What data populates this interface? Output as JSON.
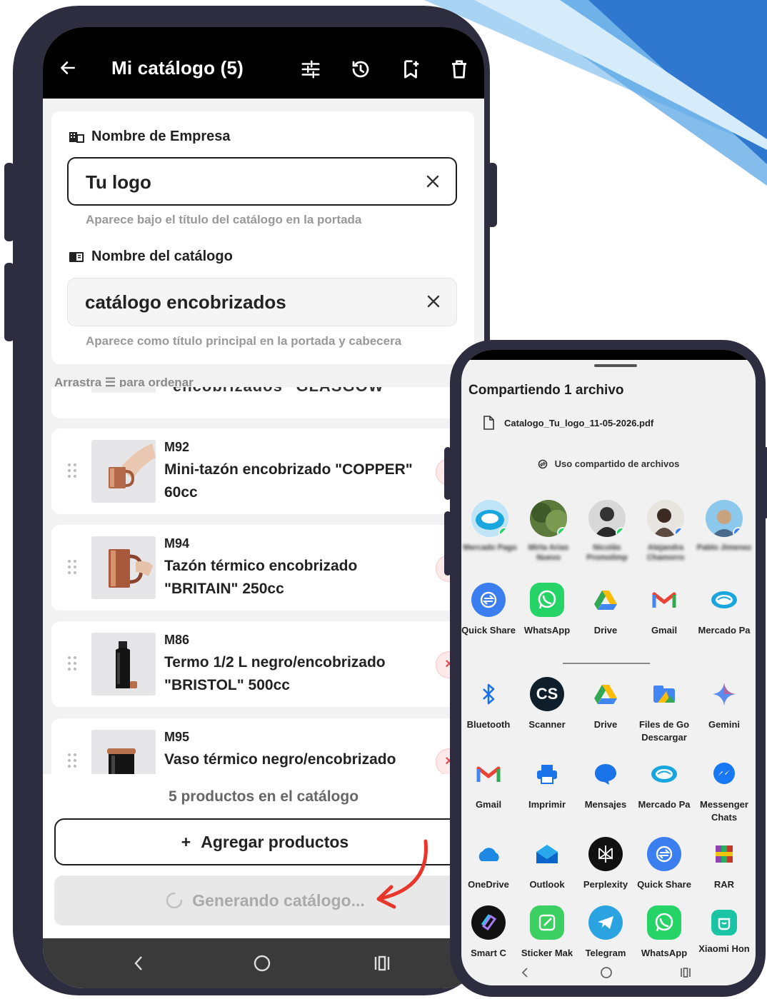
{
  "phone1": {
    "topbar": {
      "title": "Mi catálogo (5)",
      "icons": [
        "back-arrow-icon",
        "tune-icon",
        "history-icon",
        "bookmark-add-icon",
        "trash-icon"
      ]
    },
    "company": {
      "label": "Nombre de Empresa",
      "value": "Tu logo",
      "hint": "Aparece bajo el título del catálogo en la portada"
    },
    "catalog": {
      "label": "Nombre del catálogo",
      "value": "catálogo encobrizados",
      "hint": "Aparece como título principal en la portada y cabecera"
    },
    "drag_hint": "Arrastra ☰ para ordenar",
    "cut_item_text": "encobrizados \"GLASGOW\"",
    "products": [
      {
        "code": "M92",
        "name": "Mini-tazón encobrizado \"COPPER\" 60cc"
      },
      {
        "code": "M94",
        "name": "Tazón térmico encobrizado \"BRITAIN\" 250cc"
      },
      {
        "code": "M86",
        "name": "Termo 1/2 L negro/encobrizado \"BRISTOL\" 500cc"
      },
      {
        "code": "M95",
        "name": "Vaso térmico negro/encobrizado"
      }
    ],
    "remove_label": "×",
    "count_text": "5 productos en el catálogo",
    "add_button": "Agregar productos",
    "add_plus": "+",
    "generate_button": "Generando catálogo..."
  },
  "phone2": {
    "title": "Compartiendo 1 archivo",
    "file_name": "Catalogo_Tu_logo_11-05-2026.pdf",
    "nearby_label": "Uso compartido de archivos",
    "contacts": [
      {
        "name": "Mercado Pago"
      },
      {
        "name": "Mirta Arias Nuevo"
      },
      {
        "name": "Nicolás Promolimp"
      },
      {
        "name": "Alejandra Chamorro"
      },
      {
        "name": "Pablo Jimenez"
      }
    ],
    "direct_apps": [
      "Quick Share",
      "WhatsApp",
      "Drive",
      "Gmail",
      "Mercado Pa"
    ],
    "apps": [
      "Bluetooth",
      "Scanner",
      "Drive",
      "Files de Go Descargar",
      "Gemini",
      "Gmail",
      "Imprimir",
      "Mensajes",
      "Mercado Pa",
      "Messenger Chats",
      "OneDrive",
      "Outlook",
      "Perplexity",
      "Quick Share",
      "RAR",
      "Smart C",
      "Sticker Mak",
      "Telegram",
      "WhatsApp",
      "Xiaomi Hon"
    ],
    "colors": {
      "whatsapp": "#25d366",
      "quickshare": "#3b7ef0",
      "gmail_red": "#ea4335",
      "drive_yellow": "#fbbc04",
      "telegram": "#2aa3e0"
    }
  }
}
